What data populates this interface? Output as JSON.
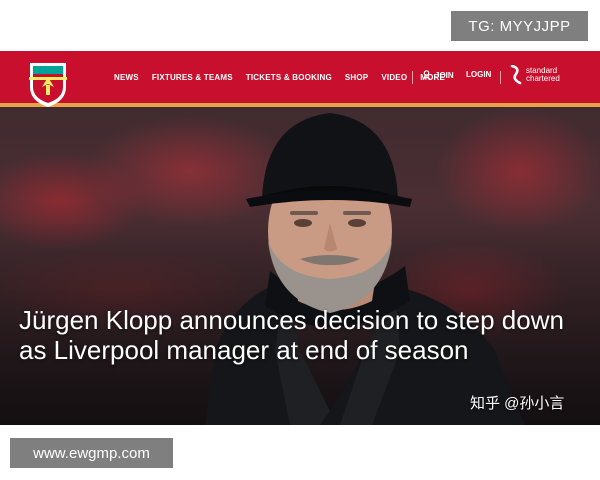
{
  "overlay_top": {
    "text": "TG: MYYJJPP"
  },
  "overlay_bottom": {
    "text": "www.ewgmp.com"
  },
  "header": {
    "crest_label": "LIVERPOOL",
    "nav_items": [
      {
        "label": "NEWS"
      },
      {
        "label": "FIXTURES & TEAMS"
      },
      {
        "label": "TICKETS & BOOKING"
      },
      {
        "label": "SHOP"
      },
      {
        "label": "VIDEO"
      },
      {
        "label": "MORE"
      }
    ],
    "join_label": "JOIN",
    "login_label": "LOGIN",
    "sponsor_line1": "standard",
    "sponsor_line2": "chartered",
    "colors": {
      "bar": "#c8102e",
      "accent": "#e8a34a"
    }
  },
  "hero": {
    "headline": "Jürgen Klopp announces decision to step down as Liverpool manager at end of season",
    "watermark": "知乎 @孙小言"
  }
}
